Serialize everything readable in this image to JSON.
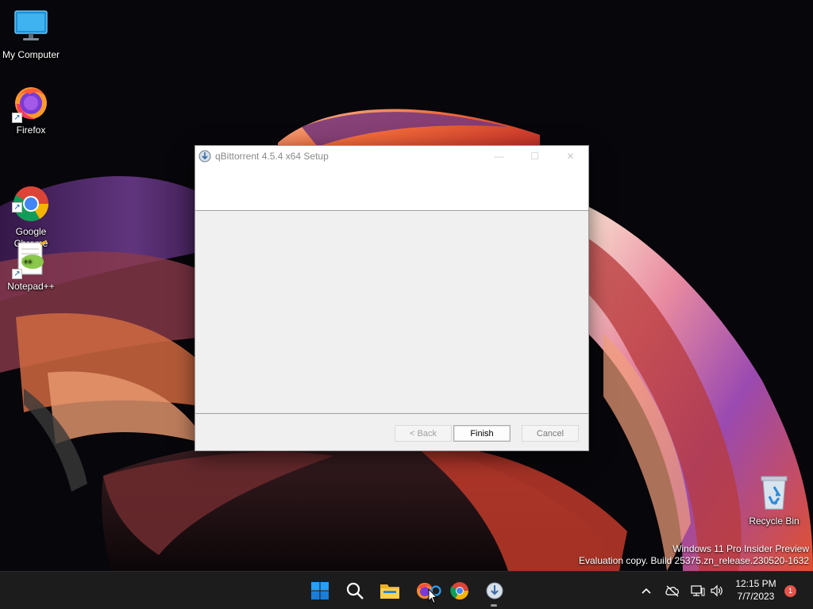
{
  "desktop": {
    "icons": [
      {
        "label": "My Computer",
        "icon": "monitor-icon"
      },
      {
        "label": "Firefox",
        "icon": "firefox-icon"
      },
      {
        "label": "Google\nChrome",
        "icon": "chrome-icon"
      },
      {
        "label": "Notepad++",
        "icon": "notepad-plus-plus-icon"
      }
    ],
    "recycle_bin": {
      "label": "Recycle Bin",
      "icon": "recycle-bin-icon"
    },
    "watermark": {
      "line1": "Windows 11 Pro Insider Preview",
      "line2": "Evaluation copy. Build 25375.zn_release.230520-1632"
    }
  },
  "setup_window": {
    "title": "qBittorrent 4.5.4 x64 Setup",
    "controls": {
      "minimize": "—",
      "maximize": "☐",
      "close": "✕"
    },
    "buttons": {
      "back": "< Back",
      "finish": "Finish",
      "cancel": "Cancel"
    }
  },
  "taskbar": {
    "apps": [
      "start-icon",
      "search-icon",
      "file-explorer-icon",
      "firefox-icon",
      "chrome-icon",
      "qbittorrent-setup-icon"
    ],
    "tray": {
      "chevron": "^",
      "time": "12:15 PM",
      "date": "7/7/2023",
      "notification_count": "1"
    }
  },
  "colors": {
    "accent_blue": "#0078d4",
    "taskbar_bg": "#1c1c1c",
    "notification_badge": "#e8534a"
  }
}
